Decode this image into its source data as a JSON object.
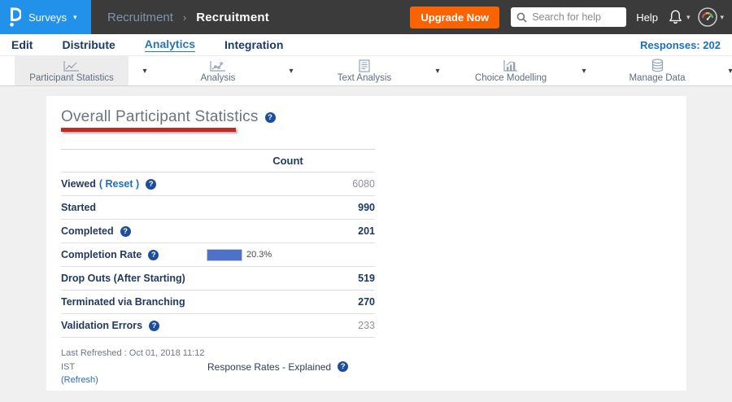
{
  "topbar": {
    "product_menu": "Surveys",
    "breadcrumb_parent": "Recruitment",
    "breadcrumb_current": "Recruitment",
    "upgrade_label": "Upgrade Now",
    "search_placeholder": "Search for help",
    "help_label": "Help"
  },
  "nav": {
    "items": [
      {
        "label": "Edit",
        "active": false
      },
      {
        "label": "Distribute",
        "active": false
      },
      {
        "label": "Analytics",
        "active": true
      },
      {
        "label": "Integration",
        "active": false
      }
    ],
    "responses_label": "Responses: 202"
  },
  "toolbar": {
    "items": [
      {
        "label": "Participant Statistics",
        "icon": "line-chart-icon",
        "selected": true
      },
      {
        "label": "Analysis",
        "icon": "scatter-line-chart-icon",
        "selected": false
      },
      {
        "label": "Text Analysis",
        "icon": "document-icon",
        "selected": false
      },
      {
        "label": "Choice Modelling",
        "icon": "framed-chart-icon",
        "selected": false
      },
      {
        "label": "Manage Data",
        "icon": "database-icon",
        "selected": false
      }
    ]
  },
  "main": {
    "title": "Overall Participant Statistics",
    "table": {
      "count_header": "Count",
      "rows": [
        {
          "label": "Viewed",
          "label_suffix": "( Reset )",
          "has_help": true,
          "value": "6080",
          "value_style": "muted"
        },
        {
          "label": "Started",
          "has_help": false,
          "value": "990",
          "value_style": "strong"
        },
        {
          "label": "Completed",
          "has_help": true,
          "value": "201",
          "value_style": "strong"
        },
        {
          "label": "Completion Rate",
          "has_help": true,
          "bar_percent": 20.3,
          "bar_label": "20.3%"
        },
        {
          "label": "Drop Outs (After Starting)",
          "has_help": false,
          "value": "519",
          "value_style": "strong"
        },
        {
          "label": "Terminated via Branching",
          "has_help": false,
          "value": "270",
          "value_style": "strong"
        },
        {
          "label": "Validation Errors",
          "has_help": true,
          "value": "233",
          "value_style": "muted"
        }
      ]
    },
    "footer": {
      "last_refreshed": "Last Refreshed : Oct 01, 2018 11:12 IST",
      "refresh_link": "(Refresh)",
      "response_rates": "Response Rates - Explained"
    }
  },
  "colors": {
    "accent_blue": "#2191ea",
    "upgrade_orange": "#f96302",
    "link_blue": "#1a6fc4",
    "bar_blue": "#4d72c9",
    "annotation_red": "#c9261f",
    "help_icon_blue": "#1d4e9e"
  }
}
